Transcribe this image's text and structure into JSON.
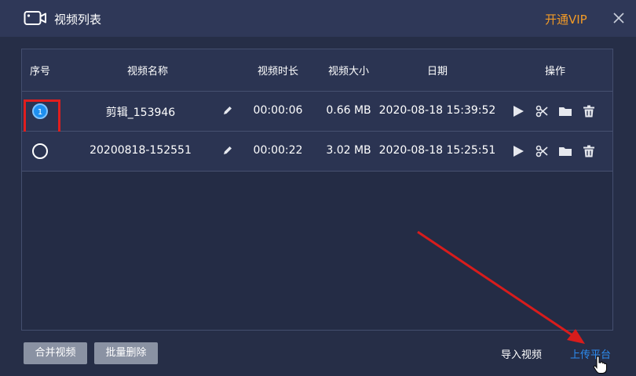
{
  "window": {
    "title": "视频列表",
    "vip_label": "开通VIP",
    "accent_color": "#f29a26",
    "icons": {
      "app": "video-camera-icon",
      "close": "close-icon"
    }
  },
  "table": {
    "headers": [
      "序号",
      "视频名称",
      "视频时长",
      "视频大小",
      "日期",
      "操作"
    ],
    "rows": [
      {
        "index": "1",
        "selected": true,
        "name": "剪辑_153946",
        "duration": "00:00:06",
        "size": "0.66 MB",
        "date": "2020-08-18 15:39:52"
      },
      {
        "index": "",
        "selected": false,
        "name": "20200818-152551",
        "duration": "00:00:22",
        "size": "3.02 MB",
        "date": "2020-08-18 15:25:51"
      }
    ],
    "row_action_icons": [
      "play-icon",
      "scissors-icon",
      "folder-icon",
      "trash-icon"
    ]
  },
  "footer": {
    "merge_label": "合并视频",
    "batch_delete_label": "批量删除",
    "import_label": "导入视频",
    "upload_label": "上传平台",
    "upload_color": "#2d8cf0"
  },
  "annotation": {
    "highlight_color": "#e01e1e"
  }
}
